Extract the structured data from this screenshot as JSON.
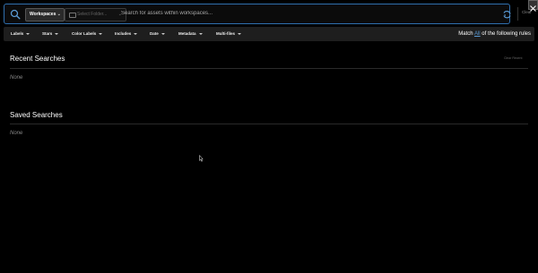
{
  "search": {
    "workspace_label": "Workspaces",
    "folder_placeholder": "Select Folder...",
    "input_placeholder": "Search for assets within workspaces...",
    "clear_label": "Clear",
    "icons": [
      "search-icon",
      "chevron-down-icon",
      "folder-icon",
      "refresh-icon",
      "close-icon"
    ]
  },
  "filters": [
    {
      "label": "Labels"
    },
    {
      "label": "Stars"
    },
    {
      "label": "Color Labels"
    },
    {
      "label": "Includes"
    },
    {
      "label": "Date"
    },
    {
      "label": "Metadata"
    },
    {
      "label": "Multi-files"
    }
  ],
  "match": {
    "prefix": "Match",
    "mode": "All",
    "suffix": "of the following rules"
  },
  "recent": {
    "title": "Recent Searches",
    "clear_label": "Clear Recent",
    "empty": "None"
  },
  "saved": {
    "title": "Saved Searches",
    "empty": "None"
  },
  "colors": {
    "background": "#000000",
    "accent": "#2f6fae",
    "link": "#5b9bd5",
    "filterbar": "#1e1e1e"
  }
}
